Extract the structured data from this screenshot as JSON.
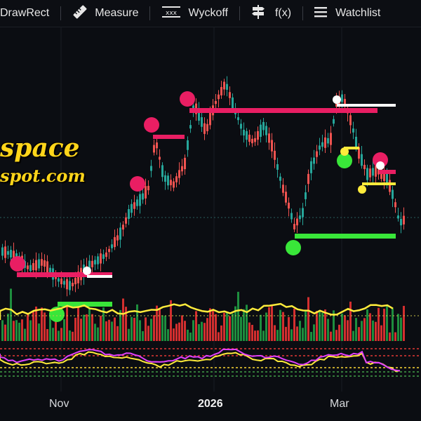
{
  "toolbar": {
    "items": [
      {
        "label": "DrawRect",
        "icon": "draw-rect-icon"
      },
      {
        "label": "Measure",
        "icon": "ruler-icon"
      },
      {
        "label": "Wyckoff",
        "icon": "wyckoff-icon"
      },
      {
        "label": "f(x)",
        "icon": "signpost-icon"
      },
      {
        "label": "Watchlist",
        "icon": "list-icon"
      }
    ]
  },
  "watermark": {
    "line1": "space",
    "line2": "spot.com"
  },
  "xaxis": {
    "labels": [
      "Nov",
      "2026",
      "Mar"
    ]
  },
  "colors": {
    "up": "#26a69a",
    "down": "#ef5350",
    "volume_up": "#1e8e3e",
    "volume_down": "#d32f2f",
    "pink_marker": "#e91e63",
    "green_marker": "#39e639",
    "yellow_line": "#ffeb3b",
    "magenta_line": "#e040fb",
    "white_line": "#ffffff",
    "background": "#0b0d12"
  }
}
